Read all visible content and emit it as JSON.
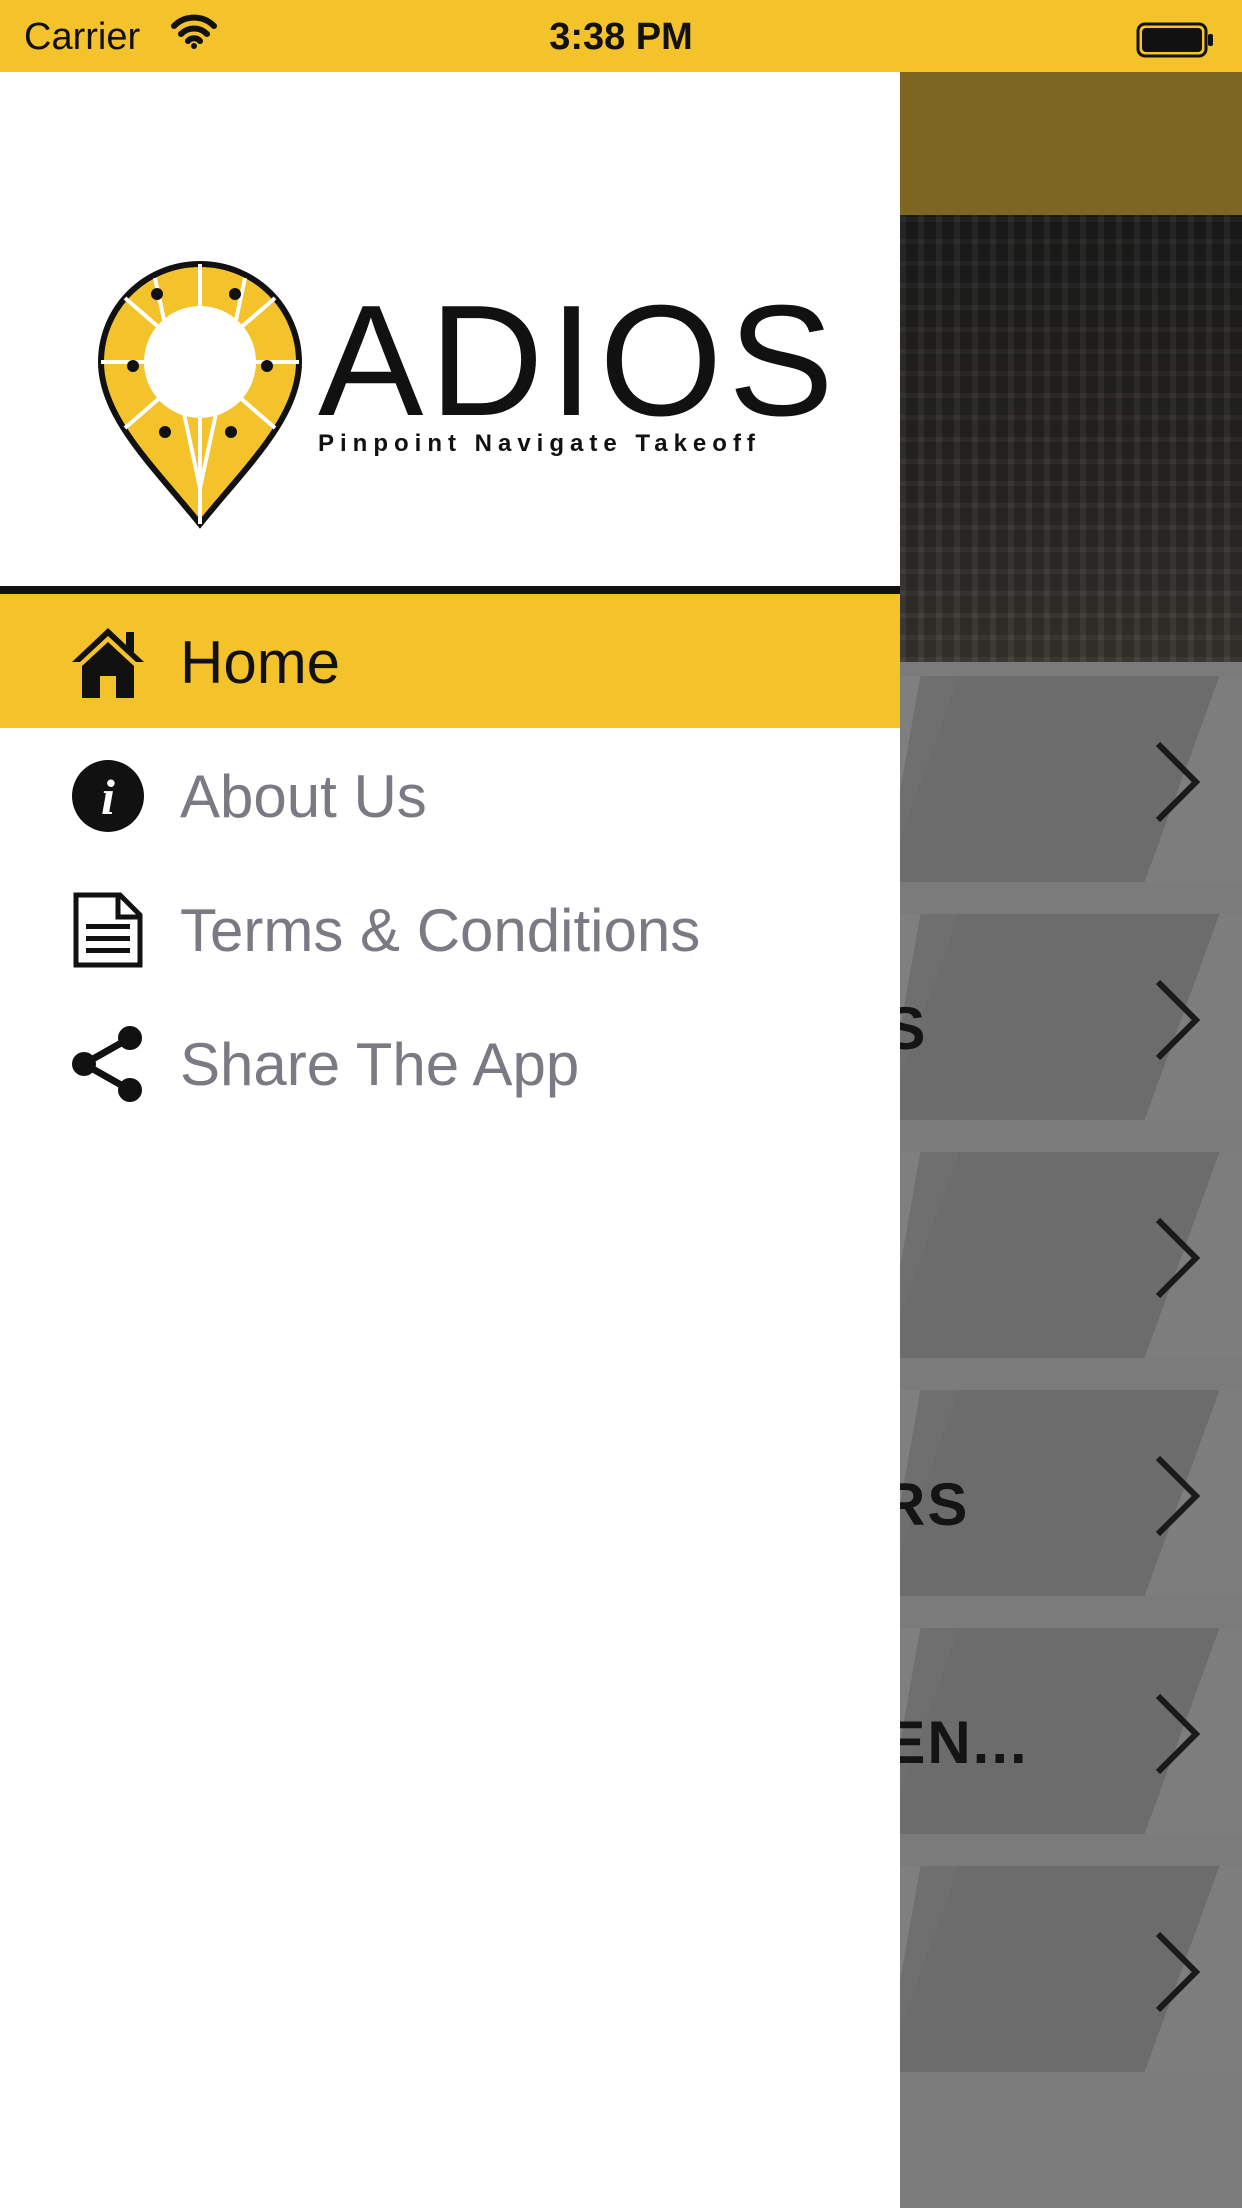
{
  "status_bar": {
    "carrier": "Carrier",
    "time": "3:38 PM"
  },
  "logo": {
    "title": "ADIOS",
    "tagline": "Pinpoint Navigate Takeoff"
  },
  "menu": {
    "items": [
      {
        "label": "Home",
        "icon": "home-icon",
        "active": true
      },
      {
        "label": "About Us",
        "icon": "info-icon",
        "active": false
      },
      {
        "label": "Terms & Conditions",
        "icon": "document-icon",
        "active": false
      },
      {
        "label": "Share The App",
        "icon": "share-icon",
        "active": false
      }
    ]
  },
  "background_list": {
    "rows": [
      {
        "label": ""
      },
      {
        "label": "RS"
      },
      {
        "label": ""
      },
      {
        "label": "ERS"
      },
      {
        "label": "CEN..."
      },
      {
        "label": ""
      }
    ]
  },
  "colors": {
    "accent": "#f4c22b",
    "drawer": "#ffffff",
    "inactive_text": "#7a7a85"
  }
}
